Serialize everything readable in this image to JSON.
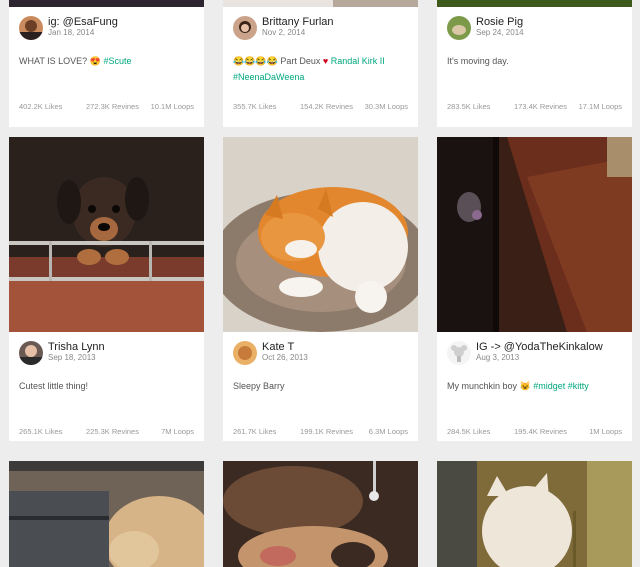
{
  "cards": [
    {
      "user": "ig: @EsaFung",
      "date": "Jan 18, 2014",
      "caption_text": "WHAT IS LOVE?",
      "caption_emoji": "😍",
      "caption_tag": "#Scute",
      "likes": "402.2K Likes",
      "revines": "272.3K Revines",
      "loops": "10.1M Loops"
    },
    {
      "user": "Brittany Furlan",
      "date": "Nov 2, 2014",
      "caption_emoji": "😂😂😂😂",
      "caption_text": "Part Deux",
      "caption_heart": "♥",
      "caption_tag": "Randal Kirk II",
      "caption_tag2": "#NeenaDaWeena",
      "likes": "355.7K Likes",
      "revines": "154.2K Revines",
      "loops": "30.3M Loops"
    },
    {
      "user": "Rosie Pig",
      "date": "Sep 24, 2014",
      "caption_text": "It's moving day.",
      "likes": "283.5K Likes",
      "revines": "173.4K Revines",
      "loops": "17.1M Loops"
    },
    {
      "user": "Trisha Lynn",
      "date": "Sep 18, 2013",
      "caption_text": "Cutest little thing!",
      "likes": "265.1K Likes",
      "revines": "225.3K Revines",
      "loops": "7M Loops"
    },
    {
      "user": "Kate T",
      "date": "Oct 26, 2013",
      "caption_text": "Sleepy Barry",
      "likes": "261.7K Likes",
      "revines": "199.1K Revines",
      "loops": "6.3M Loops"
    },
    {
      "user": "IG -> @YodaTheKinkalow",
      "date": "Aug 3, 2013",
      "caption_text": "My munchkin boy",
      "caption_emoji": "😺",
      "caption_tag": "#midget #kitty",
      "likes": "284.5K Likes",
      "revines": "195.4K Revines",
      "loops": "1M Loops"
    }
  ],
  "colors": {
    "tag": "#00a77f",
    "heart": "#d0021b",
    "background": "#ededed"
  }
}
